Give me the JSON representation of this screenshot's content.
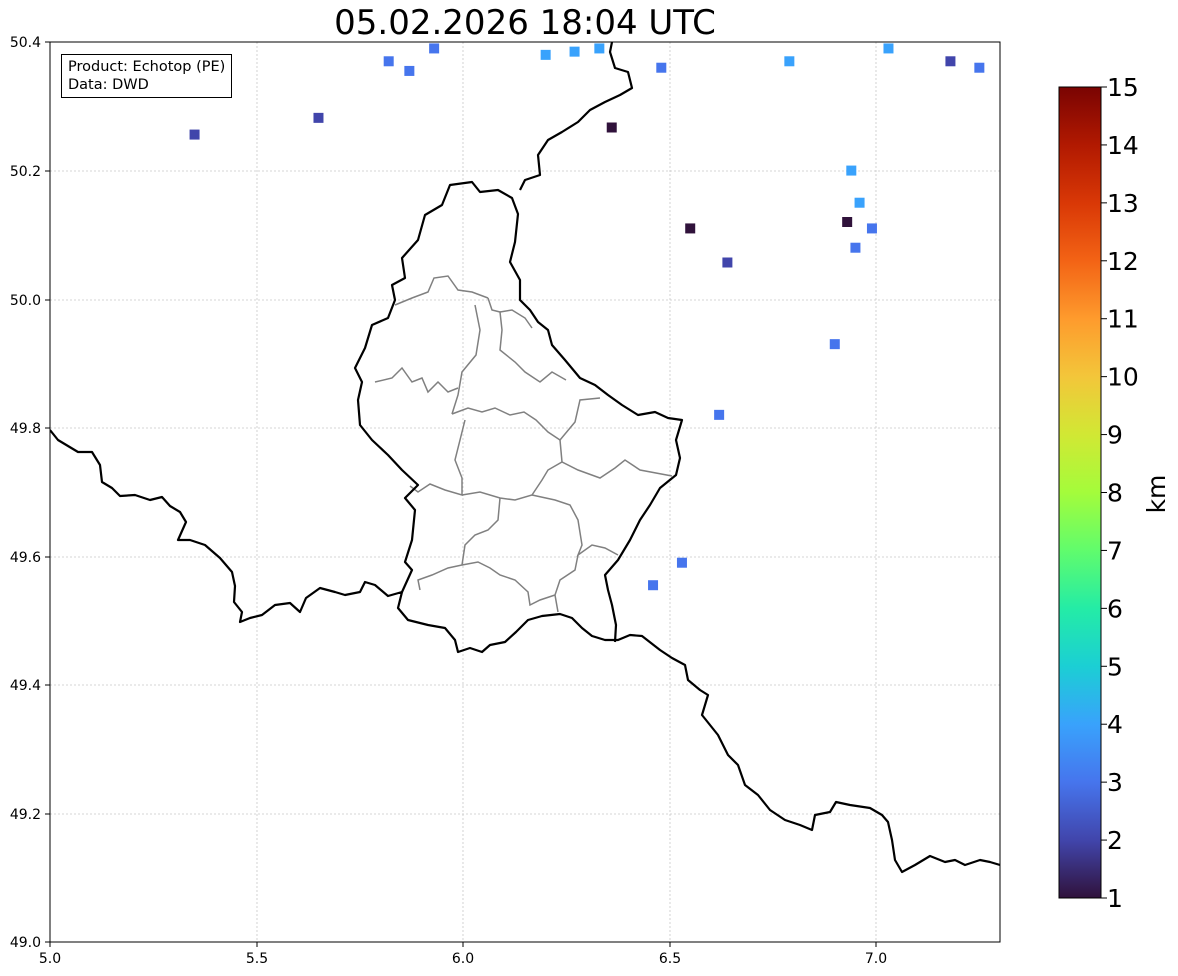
{
  "title": "05.02.2026 18:04 UTC",
  "info": {
    "product": "Product: Echotop (PE)",
    "data": "Data: DWD"
  },
  "map": {
    "lon_range": [
      5.0,
      7.3
    ],
    "lat_range": [
      49.0,
      50.4
    ],
    "x_ticks": [
      "5.0",
      "5.5",
      "6.0",
      "6.5",
      "7.0"
    ],
    "y_ticks": [
      "49.0",
      "49.2",
      "49.4",
      "49.6",
      "49.8",
      "50.0",
      "50.2",
      "50.4"
    ],
    "grid": true
  },
  "colorbar": {
    "label": "km",
    "min": 1,
    "max": 15,
    "ticks": [
      "1",
      "2",
      "3",
      "4",
      "5",
      "6",
      "7",
      "8",
      "9",
      "10",
      "11",
      "12",
      "13",
      "14",
      "15"
    ],
    "colormap": "turbo",
    "colors": [
      "#30123b",
      "#4145ab",
      "#4675ed",
      "#39a2fc",
      "#1bcfd4",
      "#24eca6",
      "#61fc6c",
      "#a4fc3b",
      "#d1e834",
      "#f3c63a",
      "#fe9b2d",
      "#f36315",
      "#d93806",
      "#b11901",
      "#7a0402"
    ]
  },
  "echo_cells": [
    {
      "lon": 5.35,
      "lat": 50.256,
      "value": 2.4
    },
    {
      "lon": 5.65,
      "lat": 50.282,
      "value": 2.1
    },
    {
      "lon": 5.82,
      "lat": 50.37,
      "value": 3.0
    },
    {
      "lon": 5.87,
      "lat": 50.355,
      "value": 2.8
    },
    {
      "lon": 5.93,
      "lat": 50.39,
      "value": 2.9
    },
    {
      "lon": 6.2,
      "lat": 50.38,
      "value": 3.9
    },
    {
      "lon": 6.27,
      "lat": 50.385,
      "value": 4.2
    },
    {
      "lon": 6.33,
      "lat": 50.39,
      "value": 3.6
    },
    {
      "lon": 6.48,
      "lat": 50.36,
      "value": 3.2
    },
    {
      "lon": 6.36,
      "lat": 50.267,
      "value": 1.3
    },
    {
      "lon": 6.55,
      "lat": 50.11,
      "value": 1.2
    },
    {
      "lon": 6.64,
      "lat": 50.057,
      "value": 1.5
    },
    {
      "lon": 6.79,
      "lat": 50.37,
      "value": 3.5
    },
    {
      "lon": 6.94,
      "lat": 50.2,
      "value": 3.8
    },
    {
      "lon": 6.96,
      "lat": 50.15,
      "value": 3.5
    },
    {
      "lon": 6.93,
      "lat": 50.12,
      "value": 1.4
    },
    {
      "lon": 6.99,
      "lat": 50.11,
      "value": 2.6
    },
    {
      "lon": 6.95,
      "lat": 50.08,
      "value": 3.4
    },
    {
      "lon": 6.9,
      "lat": 49.93,
      "value": 3.3
    },
    {
      "lon": 7.18,
      "lat": 50.37,
      "value": 1.6
    },
    {
      "lon": 7.25,
      "lat": 50.36,
      "value": 2.9
    },
    {
      "lon": 7.03,
      "lat": 50.39,
      "value": 4.3
    },
    {
      "lon": 6.62,
      "lat": 49.82,
      "value": 3.2
    },
    {
      "lon": 6.46,
      "lat": 49.555,
      "value": 3.0
    },
    {
      "lon": 6.53,
      "lat": 49.59,
      "value": 3.1
    }
  ]
}
